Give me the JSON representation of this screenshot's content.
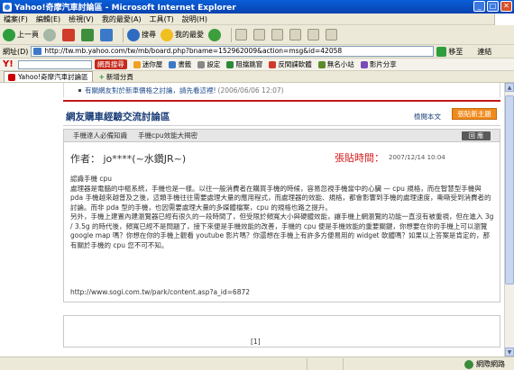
{
  "window": {
    "title": "Yahoo!奇摩汽車討論區 - Microsoft Internet Explorer",
    "buttons": [
      "_",
      "□",
      "✕"
    ]
  },
  "menu": [
    "檔案(F)",
    "編輯(E)",
    "檢視(V)",
    "我的最愛(A)",
    "工具(T)",
    "說明(H)"
  ],
  "toolbar": {
    "back_label": "上一頁",
    "search_label": "搜尋",
    "favorites_label": "我的最愛"
  },
  "address": {
    "label": "網址(D)",
    "url": "http://tw.mb.yahoo.com/tw/mb/board.php?bname=152962009&action=msg&id=42058",
    "go_label": "移至",
    "links_label": "連結"
  },
  "yahoo_toolbar": {
    "logo": "Y!",
    "items": [
      "網頁搜尋",
      "迷你屋",
      "書籤",
      "設定",
      "阻擋跳窗",
      "反間諜軟體",
      "無名小站",
      "影片分享"
    ]
  },
  "tabs": {
    "active": "Yahoo!奇摩汽車討論區",
    "new_tab": "新增分頁"
  },
  "page": {
    "top_note_link": "有關網友對於新車價格之討論，請先看這裡!",
    "top_note_date": "(2006/06/06 12:07)",
    "board_title": "網友購車經驗交流討論區",
    "back_to_list": "檢閱本文",
    "new_topic_button": "張貼新主題",
    "category": "手機達人必備知識",
    "subcategory": "手機cpu效能大揭密",
    "back_button": "回 應",
    "author_label": "作者：",
    "author": "jo****(~水鑽JR~)",
    "time_label": "張貼時間：",
    "time": "2007/12/14 10:04",
    "body": [
      "認識手機 cpu",
      "處理器是電腦的中樞系統，手機也是一樣。以往一般消費者在購買手機的時候，容易忽視手機當中的心臟 — cpu 規格，而在智慧型手機與 pda 手機越來越普及之後，這類手機往往需要處理大量的應用程式，而處理器的效能、規格，都會影響到手機的處理速度，嘶嘶受到消費者的討論。而非 pda 型的手機，也因需要處理大量的多媒體檔案，cpu 的規格也路之提升。",
      "另外，手機上建置內建瀏覽器已經有很久的一段時間了，但受限於頻寬大小與硬體效能，讓手機上網瀏覽的功能一直沒有被重視，但在進入 3g / 3.5g 的時代後，頻寬已經不是問題了，接下來便是手機效能的改善，手機的 cpu 便是手機效能的重要關鍵，你想要在你的手機上可以瀏覽 google map 嗎？你想在你的手機上觀看 youtube 影片嗎？你還想在手機上有許多方便易用的 widget 軟體嗎？如果以上答案是肯定的，那有關於手機的 cpu 您不可不知。"
    ],
    "link": "http://www.sogi.com.tw/park/content.asp?a_id=6872",
    "pager": "[1]"
  },
  "status": {
    "zone": "網際網路"
  }
}
